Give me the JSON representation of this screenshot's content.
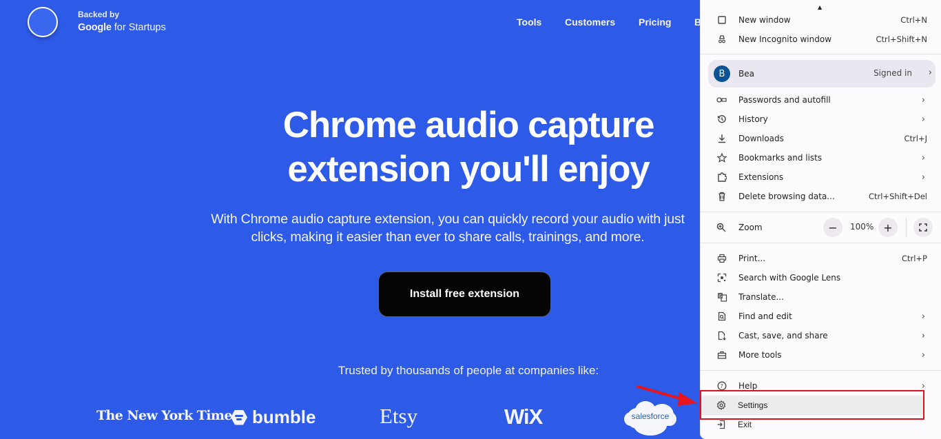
{
  "header": {
    "backed_by": "Backed by",
    "google_bold": "Google",
    "for_startups": " for Startups",
    "nav": [
      "Tools",
      "Customers",
      "Pricing",
      "B"
    ]
  },
  "hero": {
    "title_line1": "Chrome audio capture",
    "title_line2": "extension you'll enjoy",
    "subtitle_line1": "With Chrome audio capture extension, you can quickly record your audio with just",
    "subtitle_line2": "clicks, making it easier than ever to share calls, trainings, and more.",
    "cta": "Install free extension",
    "trusted": "Trusted by thousands of people at companies like:",
    "logos": {
      "nyt": "The New York Times",
      "bumble": "bumble",
      "etsy": "Etsy",
      "wix": "WiX",
      "salesforce": "salesforce"
    }
  },
  "colors": {
    "page_bg": "#2e5ae8",
    "menu_bg": "#fdfbfe",
    "highlight": "#e0131d",
    "avatar": "#0b5394"
  },
  "menu": {
    "top_items": [
      {
        "label": "New window",
        "shortcut": "Ctrl+N",
        "icon": "new-window-icon"
      },
      {
        "label": "New Incognito window",
        "shortcut": "Ctrl+Shift+N",
        "icon": "incognito-icon"
      }
    ],
    "profile": {
      "initial": "B",
      "name": "Bea",
      "status": "Signed in"
    },
    "group2": [
      {
        "label": "Passwords and autofill",
        "shortcut": "",
        "submenu": true,
        "icon": "key-icon"
      },
      {
        "label": "History",
        "shortcut": "",
        "submenu": true,
        "icon": "history-icon"
      },
      {
        "label": "Downloads",
        "shortcut": "Ctrl+J",
        "submenu": false,
        "icon": "download-icon"
      },
      {
        "label": "Bookmarks and lists",
        "shortcut": "",
        "submenu": true,
        "icon": "star-icon"
      },
      {
        "label": "Extensions",
        "shortcut": "",
        "submenu": true,
        "icon": "puzzle-icon"
      },
      {
        "label": "Delete browsing data...",
        "shortcut": "Ctrl+Shift+Del",
        "submenu": false,
        "icon": "trash-icon"
      }
    ],
    "zoom": {
      "label": "Zoom",
      "value": "100%",
      "minus": "−",
      "plus": "+"
    },
    "group3": [
      {
        "label": "Print...",
        "shortcut": "Ctrl+P",
        "submenu": false,
        "icon": "print-icon"
      },
      {
        "label": "Search with Google Lens",
        "shortcut": "",
        "submenu": false,
        "icon": "lens-icon"
      },
      {
        "label": "Translate...",
        "shortcut": "",
        "submenu": false,
        "icon": "translate-icon"
      },
      {
        "label": "Find and edit",
        "shortcut": "",
        "submenu": true,
        "icon": "find-icon"
      },
      {
        "label": "Cast, save, and share",
        "shortcut": "",
        "submenu": true,
        "icon": "cast-save-icon"
      },
      {
        "label": "More tools",
        "shortcut": "",
        "submenu": true,
        "icon": "toolbox-icon"
      }
    ],
    "group4": [
      {
        "label": "Help",
        "shortcut": "",
        "submenu": true,
        "icon": "help-icon"
      },
      {
        "label": "Settings",
        "shortcut": "",
        "submenu": false,
        "icon": "gear-icon"
      },
      {
        "label": "Exit",
        "shortcut": "",
        "submenu": false,
        "icon": "exit-icon"
      }
    ],
    "chevron": "›"
  }
}
